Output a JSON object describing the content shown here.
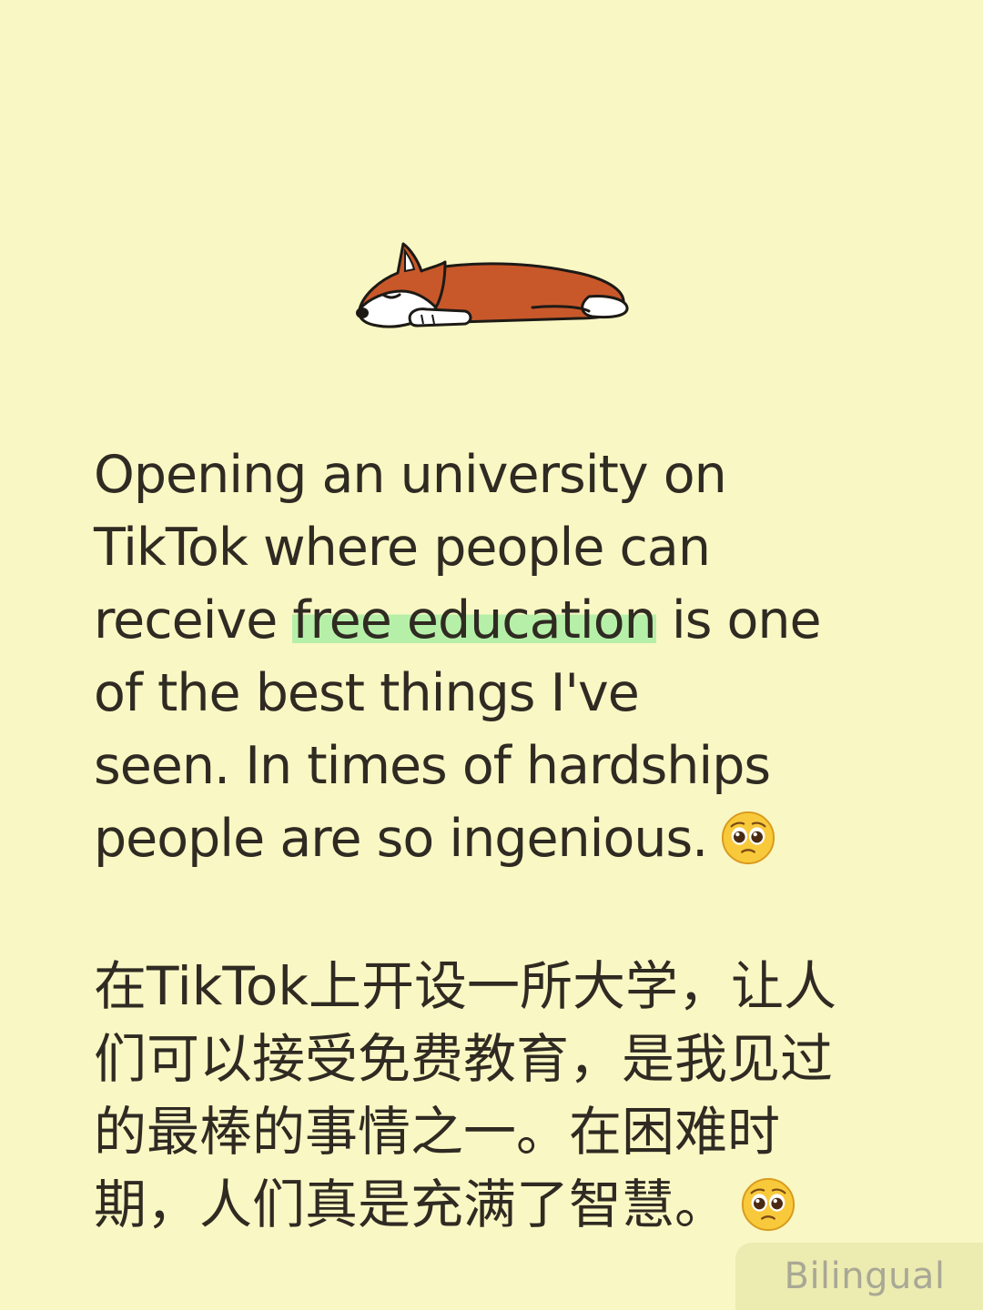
{
  "illustration": {
    "icon": "sleeping-corgi-icon"
  },
  "english": {
    "line1": "Opening an university on",
    "line2": "TikTok where people can",
    "line3_before": "receive ",
    "line3_highlight": "free education",
    "line3_after": " is one",
    "line4": "of the best things I've",
    "line5": "seen. In times of hardships",
    "line6": "people are so ingenious.",
    "emoji": "pleading-face-emoji",
    "highlight_color": "#b6f0a8"
  },
  "chinese": {
    "line1": "在TikTok上开设一所大学，让人",
    "line2": "们可以接受免费教育，是我见过",
    "line3": "的最棒的事情之一。在困难时",
    "line4": "期，人们真是充满了智慧。",
    "emoji": "pleading-face-emoji"
  },
  "badge": {
    "label": "Bilingual"
  },
  "colors": {
    "background": "#f9f7c3",
    "text": "#2f2a22",
    "badge_bg": "#ecebb0",
    "badge_text": "#a9a895"
  }
}
